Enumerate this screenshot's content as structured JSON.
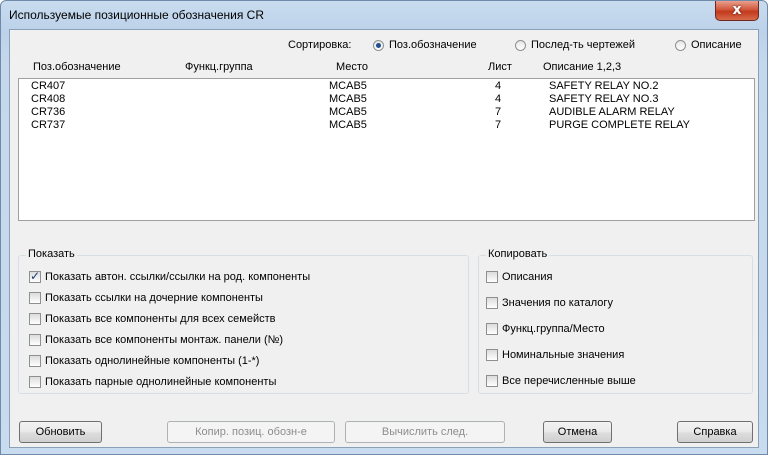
{
  "window": {
    "title": "Используемые позиционные обозначения CR",
    "close_glyph": "x"
  },
  "sort": {
    "label": "Сортировка:",
    "options": [
      {
        "label": "Поз.обозначение",
        "selected": true
      },
      {
        "label": "Послед-ть чертежей",
        "selected": false
      },
      {
        "label": "Описание",
        "selected": false
      }
    ]
  },
  "table": {
    "columns": [
      "Поз.обозначение",
      "Функц.группа",
      "Место",
      "Лист",
      "Описание 1,2,3"
    ],
    "rows": [
      {
        "tag": "CR407",
        "group": "",
        "location": "MCAB5",
        "sheet": "4",
        "description": "SAFETY RELAY NO.2"
      },
      {
        "tag": "CR408",
        "group": "",
        "location": "MCAB5",
        "sheet": "4",
        "description": "SAFETY RELAY NO.3"
      },
      {
        "tag": "CR736",
        "group": "",
        "location": "MCAB5",
        "sheet": "7",
        "description": "AUDIBLE ALARM RELAY"
      },
      {
        "tag": "CR737",
        "group": "",
        "location": "MCAB5",
        "sheet": "7",
        "description": "PURGE COMPLETE RELAY"
      }
    ]
  },
  "show": {
    "title": "Показать",
    "items": [
      {
        "label": "Показать автон. ссылки/ссылки на род. компоненты",
        "checked": true
      },
      {
        "label": "Показать ссылки на дочерние компоненты",
        "checked": false
      },
      {
        "label": "Показать все компоненты для всех семейств",
        "checked": false
      },
      {
        "label": "Показать все компоненты монтаж. панели (№)",
        "checked": false
      },
      {
        "label": "Показать однолинейные компоненты (1-*)",
        "checked": false
      },
      {
        "label": "Показать парные однолинейные компоненты",
        "checked": false
      }
    ]
  },
  "copy": {
    "title": "Копировать",
    "items": [
      {
        "label": "Описания",
        "checked": false
      },
      {
        "label": "Значения по каталогу",
        "checked": false
      },
      {
        "label": "Функц.группа/Место",
        "checked": false
      },
      {
        "label": "Номинальные значения",
        "checked": false
      },
      {
        "label": "Все перечисленные выше",
        "checked": false
      }
    ]
  },
  "buttons": {
    "refresh": "Обновить",
    "copy_tag": "Копир. позиц. обозн-е",
    "compute_next": "Вычислить след.",
    "cancel": "Отмена",
    "help": "Справка"
  }
}
